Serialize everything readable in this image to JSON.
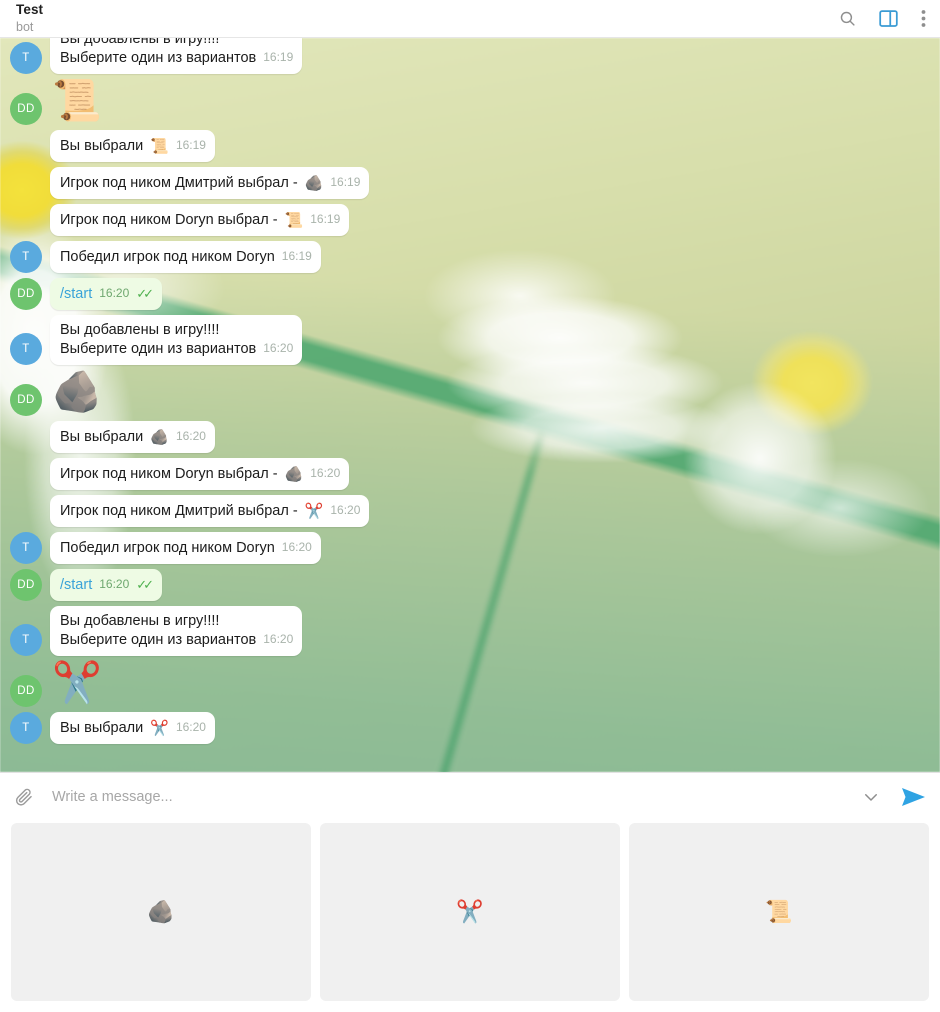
{
  "header": {
    "title": "Test",
    "subtitle": "bot",
    "icons": {
      "search": "search-icon",
      "sidebar": "sidebar-toggle-icon",
      "menu": "more-vertical-icon"
    }
  },
  "chat": {
    "messages": [
      {
        "id": "m1",
        "avatar": "T",
        "avatar_color": "blue",
        "side": "in",
        "kind": "text",
        "text": "Вы добавлены в игру!!!!\nВыберите один из вариантов",
        "time": "16:19",
        "clipped_top": true
      },
      {
        "id": "m2",
        "avatar": "DD",
        "avatar_color": "green",
        "side": "in",
        "kind": "sticker",
        "emoji": "📜",
        "time": ""
      },
      {
        "id": "m3",
        "avatar": "",
        "avatar_color": "",
        "side": "in",
        "kind": "text",
        "text": "Вы выбрали",
        "emoji": "📜",
        "time": "16:19"
      },
      {
        "id": "m4",
        "avatar": "",
        "avatar_color": "",
        "side": "in",
        "kind": "text",
        "text": "Игрок под ником Дмитрий выбрал - ",
        "emoji": "🪨",
        "time": "16:19"
      },
      {
        "id": "m5",
        "avatar": "",
        "avatar_color": "",
        "side": "in",
        "kind": "text",
        "text": "Игрок под ником Doryn выбрал - ",
        "emoji": "📜",
        "time": "16:19"
      },
      {
        "id": "m6",
        "avatar": "T",
        "avatar_color": "blue",
        "side": "in",
        "kind": "text",
        "text": "Победил игрок под ником Doryn",
        "time": "16:19"
      },
      {
        "id": "m7",
        "avatar": "DD",
        "avatar_color": "green",
        "side": "out",
        "kind": "command",
        "text": "/start",
        "time": "16:20",
        "ticks": "✓✓"
      },
      {
        "id": "m8",
        "avatar": "T",
        "avatar_color": "blue",
        "side": "in",
        "kind": "text",
        "text": "Вы добавлены в игру!!!!\nВыберите один из вариантов",
        "time": "16:20"
      },
      {
        "id": "m9",
        "avatar": "DD",
        "avatar_color": "green",
        "side": "in",
        "kind": "sticker",
        "emoji": "🪨",
        "time": ""
      },
      {
        "id": "m10",
        "avatar": "",
        "avatar_color": "",
        "side": "in",
        "kind": "text",
        "text": "Вы выбрали",
        "emoji": "🪨",
        "time": "16:20"
      },
      {
        "id": "m11",
        "avatar": "",
        "avatar_color": "",
        "side": "in",
        "kind": "text",
        "text": "Игрок под ником Doryn выбрал - ",
        "emoji": "🪨",
        "time": "16:20"
      },
      {
        "id": "m12",
        "avatar": "",
        "avatar_color": "",
        "side": "in",
        "kind": "text",
        "text": "Игрок под ником Дмитрий выбрал - ",
        "emoji": "✂️",
        "time": "16:20"
      },
      {
        "id": "m13",
        "avatar": "T",
        "avatar_color": "blue",
        "side": "in",
        "kind": "text",
        "text": "Победил игрок под ником Doryn",
        "time": "16:20"
      },
      {
        "id": "m14",
        "avatar": "DD",
        "avatar_color": "green",
        "side": "out",
        "kind": "command",
        "text": "/start",
        "time": "16:20",
        "ticks": "✓✓"
      },
      {
        "id": "m15",
        "avatar": "T",
        "avatar_color": "blue",
        "side": "in",
        "kind": "text",
        "text": "Вы добавлены в игру!!!!\nВыберите один из вариантов",
        "time": "16:20"
      },
      {
        "id": "m16",
        "avatar": "DD",
        "avatar_color": "green",
        "side": "in",
        "kind": "sticker",
        "emoji": "✂️",
        "time": ""
      },
      {
        "id": "m17",
        "avatar": "T",
        "avatar_color": "blue",
        "side": "in",
        "kind": "text",
        "text": "Вы выбрали",
        "emoji": "✂️",
        "time": "16:20"
      }
    ]
  },
  "composer": {
    "placeholder": "Write a message...",
    "value": "",
    "attach_icon": "paperclip-icon",
    "expand_icon": "chevron-down-icon",
    "send_icon": "send-icon"
  },
  "bot_keyboard": {
    "buttons": [
      {
        "label": "🪨",
        "name": "rock"
      },
      {
        "label": "✂️",
        "name": "scissors"
      },
      {
        "label": "📜",
        "name": "paper"
      }
    ]
  },
  "colors": {
    "accent": "#3aa3d8",
    "send": "#2fa3e3",
    "avatar_blue": "#5aaade",
    "avatar_green": "#6ec46e",
    "outgoing_bubble": "#eefbe4",
    "tick_green": "#4fb14f"
  }
}
